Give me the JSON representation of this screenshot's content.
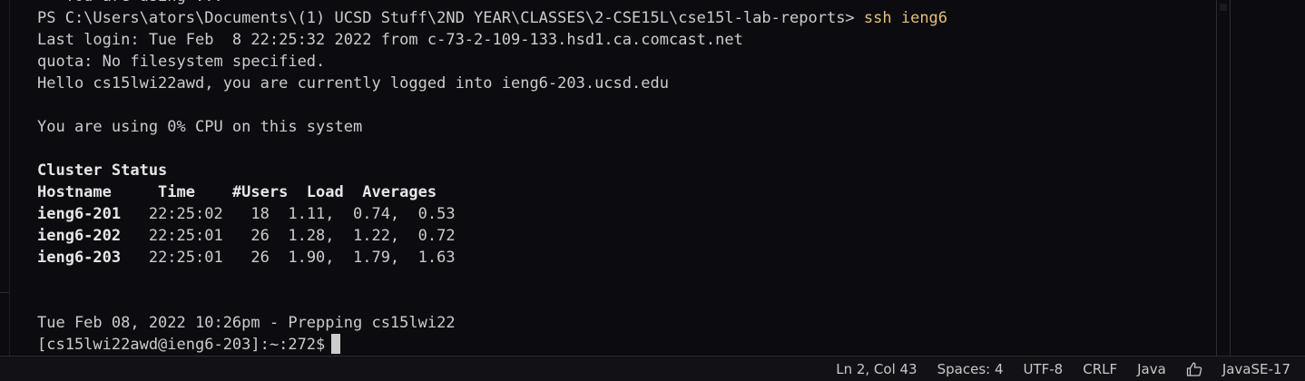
{
  "terminal": {
    "lines": [
      {
        "text": "   You are using ...",
        "style": "normal"
      },
      {
        "prompt": "PS C:\\Users\\ators\\Documents\\(1) UCSD Stuff\\2ND YEAR\\CLASSES\\2-CSE15L\\cse15l-lab-reports> ",
        "command": "ssh ieng6"
      },
      {
        "text": "Last login: Tue Feb  8 22:25:32 2022 from c-73-2-109-133.hsd1.ca.comcast.net",
        "style": "normal"
      },
      {
        "text": "quota: No filesystem specified.",
        "style": "normal"
      },
      {
        "text": "Hello cs15lwi22awd, you are currently logged into ieng6-203.ucsd.edu",
        "style": "normal"
      },
      {
        "text": "",
        "style": "normal"
      },
      {
        "text": "You are using 0% CPU on this system",
        "style": "normal"
      },
      {
        "text": "",
        "style": "normal"
      },
      {
        "text": "Cluster Status",
        "style": "bold"
      },
      {
        "text": "Hostname     Time    #Users  Load  Averages",
        "style": "bold"
      },
      {
        "host": "ieng6-201",
        "rest": "   22:25:02   18  1.11,  0.74,  0.53"
      },
      {
        "host": "ieng6-202",
        "rest": "   22:25:01   26  1.28,  1.22,  0.72"
      },
      {
        "host": "ieng6-203",
        "rest": "   22:25:01   26  1.90,  1.79,  1.63"
      },
      {
        "text": "",
        "style": "normal"
      },
      {
        "text": "",
        "style": "normal"
      },
      {
        "text": "Tue Feb 08, 2022 10:26pm - Prepping cs15lwi22",
        "style": "normal"
      },
      {
        "text": "[cs15lwi22awd@ieng6-203]:~:272$",
        "style": "prompt-cursor"
      }
    ]
  },
  "statusbar": {
    "position": "Ln 2, Col 43",
    "spaces": "Spaces: 4",
    "encoding": "UTF-8",
    "eol": "CRLF",
    "language": "Java",
    "feedback_icon": "thumbs-up-icon",
    "java_version": "JavaSE-17"
  }
}
